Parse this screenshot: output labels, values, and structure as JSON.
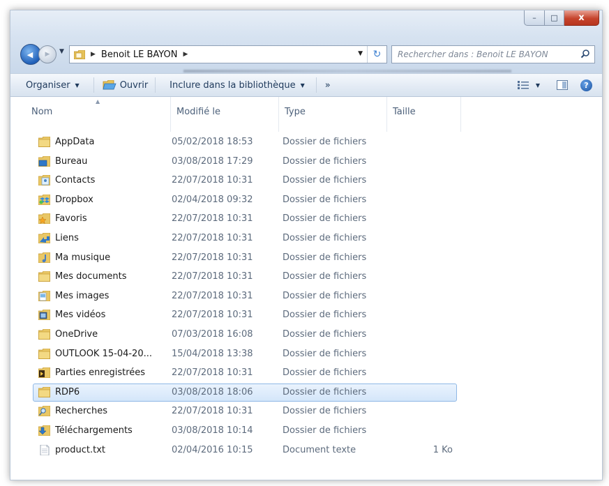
{
  "window": {
    "controls": {
      "minimize": "–",
      "maximize": "□",
      "close": "x"
    }
  },
  "navigation": {
    "back_glyph": "◀",
    "forward_glyph": "▶",
    "history_dropdown": "▼"
  },
  "address": {
    "path_separator": "▶",
    "location": "Benoit LE BAYON",
    "trailing_separator": "▶",
    "dropdown": "▼",
    "refresh_glyph": "↻"
  },
  "search": {
    "placeholder": "Rechercher dans : Benoit LE BAYON"
  },
  "toolbar": {
    "organiser": "Organiser",
    "ouvrir": "Ouvrir",
    "inclure": "Inclure dans la bibliothèque",
    "more": "»",
    "caret": "▼",
    "help": "?"
  },
  "columns": {
    "nom": "Nom",
    "modifie": "Modifié le",
    "type": "Type",
    "taille": "Taille",
    "sort_indicator": "▲"
  },
  "colors": {
    "folder": "#e6c25a",
    "folder_dark": "#c99a2a",
    "accent": "#1f5fb8",
    "selected_border": "#8fb8e6"
  },
  "files": [
    {
      "name": "AppData",
      "modified": "05/02/2018 18:53",
      "type": "Dossier de fichiers",
      "size": "",
      "icon": "folder-icon"
    },
    {
      "name": "Bureau",
      "modified": "03/08/2018 17:29",
      "type": "Dossier de fichiers",
      "size": "",
      "icon": "desktop-folder-icon"
    },
    {
      "name": "Contacts",
      "modified": "22/07/2018 10:31",
      "type": "Dossier de fichiers",
      "size": "",
      "icon": "contacts-folder-icon"
    },
    {
      "name": "Dropbox",
      "modified": "02/04/2018 09:32",
      "type": "Dossier de fichiers",
      "size": "",
      "icon": "dropbox-folder-icon"
    },
    {
      "name": "Favoris",
      "modified": "22/07/2018 10:31",
      "type": "Dossier de fichiers",
      "size": "",
      "icon": "favorites-folder-icon"
    },
    {
      "name": "Liens",
      "modified": "22/07/2018 10:31",
      "type": "Dossier de fichiers",
      "size": "",
      "icon": "links-folder-icon"
    },
    {
      "name": "Ma musique",
      "modified": "22/07/2018 10:31",
      "type": "Dossier de fichiers",
      "size": "",
      "icon": "music-folder-icon"
    },
    {
      "name": "Mes documents",
      "modified": "22/07/2018 10:31",
      "type": "Dossier de fichiers",
      "size": "",
      "icon": "documents-folder-icon"
    },
    {
      "name": "Mes images",
      "modified": "22/07/2018 10:31",
      "type": "Dossier de fichiers",
      "size": "",
      "icon": "pictures-folder-icon"
    },
    {
      "name": "Mes vidéos",
      "modified": "22/07/2018 10:31",
      "type": "Dossier de fichiers",
      "size": "",
      "icon": "videos-folder-icon"
    },
    {
      "name": "OneDrive",
      "modified": "07/03/2018 16:08",
      "type": "Dossier de fichiers",
      "size": "",
      "icon": "folder-icon"
    },
    {
      "name": "OUTLOOK 15-04-20...",
      "modified": "15/04/2018 13:38",
      "type": "Dossier de fichiers",
      "size": "",
      "icon": "folder-icon"
    },
    {
      "name": "Parties enregistrées",
      "modified": "22/07/2018 10:31",
      "type": "Dossier de fichiers",
      "size": "",
      "icon": "saved-games-folder-icon"
    },
    {
      "name": "RDP6",
      "modified": "03/08/2018 18:06",
      "type": "Dossier de fichiers",
      "size": "",
      "icon": "folder-icon",
      "selected": true
    },
    {
      "name": "Recherches",
      "modified": "22/07/2018 10:31",
      "type": "Dossier de fichiers",
      "size": "",
      "icon": "searches-folder-icon"
    },
    {
      "name": "Téléchargements",
      "modified": "03/08/2018 10:14",
      "type": "Dossier de fichiers",
      "size": "",
      "icon": "downloads-folder-icon"
    },
    {
      "name": "product.txt",
      "modified": "02/04/2016 10:15",
      "type": "Document texte",
      "size": "1 Ko",
      "icon": "text-file-icon"
    }
  ]
}
